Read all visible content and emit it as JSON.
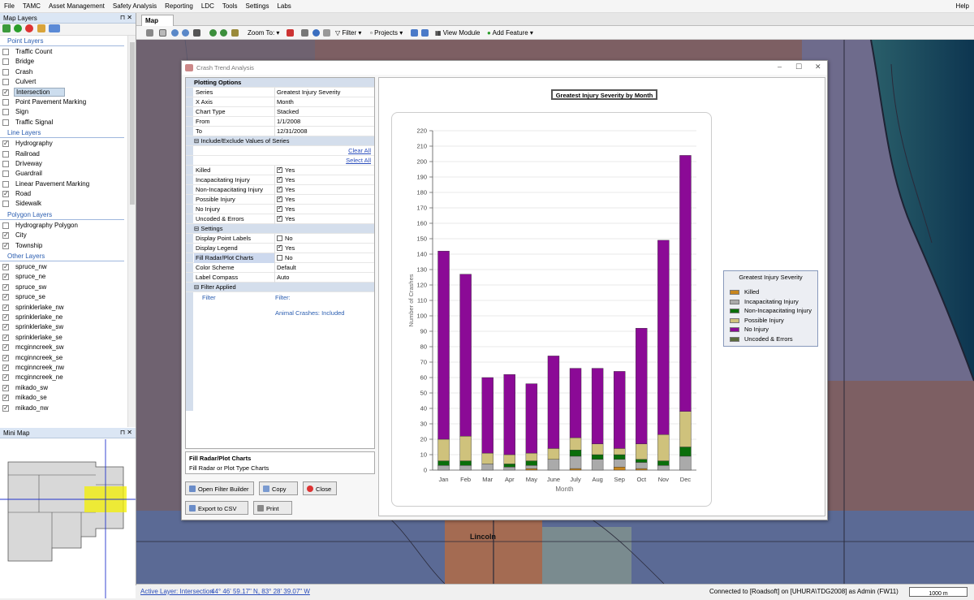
{
  "menu": [
    "File",
    "TAMC",
    "Asset Management",
    "Safety Analysis",
    "Reporting",
    "LDC",
    "Tools",
    "Settings",
    "Labs"
  ],
  "help_label": "Help",
  "map_layers": {
    "title": "Map Layers",
    "groups": [
      {
        "label": "Point Layers",
        "layers": [
          {
            "name": "Traffic Count",
            "checked": false
          },
          {
            "name": "Bridge",
            "checked": false
          },
          {
            "name": "Crash",
            "checked": false
          },
          {
            "name": "Culvert",
            "checked": false
          },
          {
            "name": "Intersection",
            "checked": true,
            "selected": true
          },
          {
            "name": "Point Pavement Marking",
            "checked": false
          },
          {
            "name": "Sign",
            "checked": false
          },
          {
            "name": "Traffic Signal",
            "checked": false
          }
        ]
      },
      {
        "label": "Line Layers",
        "layers": [
          {
            "name": "Hydrography",
            "checked": true
          },
          {
            "name": "Railroad",
            "checked": false
          },
          {
            "name": "Driveway",
            "checked": false
          },
          {
            "name": "Guardrail",
            "checked": false
          },
          {
            "name": "Linear Pavement Marking",
            "checked": false
          },
          {
            "name": "Road",
            "checked": true
          },
          {
            "name": "Sidewalk",
            "checked": false
          }
        ]
      },
      {
        "label": "Polygon Layers",
        "layers": [
          {
            "name": "Hydrography Polygon",
            "checked": false
          },
          {
            "name": "City",
            "checked": true
          },
          {
            "name": "Township",
            "checked": true
          }
        ]
      },
      {
        "label": "Other Layers",
        "layers": [
          {
            "name": "spruce_nw",
            "checked": true
          },
          {
            "name": "spruce_ne",
            "checked": true
          },
          {
            "name": "spruce_sw",
            "checked": true
          },
          {
            "name": "spruce_se",
            "checked": true
          },
          {
            "name": "sprinklerlake_nw",
            "checked": true
          },
          {
            "name": "sprinklerlake_ne",
            "checked": true
          },
          {
            "name": "sprinklerlake_sw",
            "checked": true
          },
          {
            "name": "sprinklerlake_se",
            "checked": true
          },
          {
            "name": "mcginncreek_sw",
            "checked": true
          },
          {
            "name": "mcginncreek_se",
            "checked": true
          },
          {
            "name": "mcginncreek_nw",
            "checked": true
          },
          {
            "name": "mcginncreek_ne",
            "checked": true
          },
          {
            "name": "mikado_sw",
            "checked": true
          },
          {
            "name": "mikado_se",
            "checked": true
          },
          {
            "name": "mikado_nw",
            "checked": true
          }
        ]
      }
    ]
  },
  "mini_map": {
    "title": "Mini Map"
  },
  "map_tab": "Map",
  "map_toolbar": {
    "zoom_to": "Zoom To:",
    "filter": "Filter",
    "projects": "Projects",
    "view_module": "View Module",
    "add_feature": "Add Feature"
  },
  "map_label": "Lincoln",
  "status": {
    "active_layer": "Active Layer: Intersection",
    "coords": "44° 46' 59.17\" N, 83° 28' 39.07\" W",
    "connection": "Connected to [Roadsoft] on [UHURA\\TDG2008] as Admin (FW11)",
    "scale": "1000 m"
  },
  "dialog": {
    "title": "Crash Trend Analysis",
    "plotting_options": "Plotting Options",
    "props": [
      {
        "k": "Series",
        "v": "Greatest Injury Severity"
      },
      {
        "k": "X Axis",
        "v": "Month"
      },
      {
        "k": "Chart Type",
        "v": "Stacked"
      },
      {
        "k": "From",
        "v": "1/1/2008"
      },
      {
        "k": "To",
        "v": "12/31/2008"
      }
    ],
    "include_section": "Include/Exclude Values of Series",
    "clear_all": "Clear All",
    "select_all": "Select All",
    "include_values": [
      {
        "k": "Killed",
        "v": "Yes",
        "checked": true
      },
      {
        "k": "Incapacitating Injury",
        "v": "Yes",
        "checked": true
      },
      {
        "k": "Non-Incapacitating Injury",
        "v": "Yes",
        "checked": true
      },
      {
        "k": "Possible Injury",
        "v": "Yes",
        "checked": true
      },
      {
        "k": "No Injury",
        "v": "Yes",
        "checked": true
      },
      {
        "k": "Uncoded & Errors",
        "v": "Yes",
        "checked": true
      }
    ],
    "settings_section": "Settings",
    "settings": [
      {
        "k": "Display Point Labels",
        "v": "No",
        "checked": false,
        "cb": true
      },
      {
        "k": "Display Legend",
        "v": "Yes",
        "checked": true,
        "cb": true
      },
      {
        "k": "Fill Radar/Plot Charts",
        "v": "No",
        "checked": false,
        "cb": true,
        "hl": true
      },
      {
        "k": "Color Scheme",
        "v": "Default",
        "cb": false
      },
      {
        "k": "Label Compass",
        "v": "Auto",
        "cb": false
      }
    ],
    "filter_section": "Filter Applied",
    "filter_key": "Filter",
    "filter_value": "Filter:",
    "filter_detail": "Animal Crashes:  Included",
    "desc_title": "Fill Radar/Plot Charts",
    "desc_text": "Fill Radar or Plot Type Charts",
    "buttons": {
      "open_filter": "Open Filter Builder",
      "copy": "Copy",
      "close": "Close",
      "export": "Export to CSV",
      "print": "Print"
    }
  },
  "chart_data": {
    "type": "bar",
    "stacked": true,
    "title": "Greatest Injury Severity by Month",
    "xlabel": "Month",
    "ylabel": "Number of Crashes",
    "ylim": [
      0,
      220
    ],
    "yticks": [
      0,
      10,
      20,
      30,
      40,
      50,
      60,
      70,
      80,
      90,
      100,
      110,
      120,
      130,
      140,
      150,
      160,
      170,
      180,
      190,
      200,
      210,
      220
    ],
    "grid": true,
    "legend_title": "Greatest Injury Severity",
    "legend_position": "right",
    "categories": [
      "Jan",
      "Feb",
      "Mar",
      "Apr",
      "May",
      "June",
      "July",
      "Aug",
      "Sep",
      "Oct",
      "Nov",
      "Dec"
    ],
    "series": [
      {
        "name": "Killed",
        "color": "#c8861e",
        "values": [
          0,
          0,
          0,
          0,
          1,
          0,
          1,
          0,
          2,
          1,
          0,
          0
        ]
      },
      {
        "name": "Incapacitating Injury",
        "color": "#aaaaaa",
        "values": [
          3,
          3,
          4,
          2,
          2,
          7,
          8,
          7,
          5,
          4,
          3,
          9
        ]
      },
      {
        "name": "Non-Incapacitating Injury",
        "color": "#0a6e0a",
        "values": [
          3,
          3,
          0,
          2,
          3,
          0,
          4,
          3,
          3,
          2,
          3,
          6
        ]
      },
      {
        "name": "Possible Injury",
        "color": "#cfc27c",
        "values": [
          14,
          16,
          7,
          6,
          5,
          7,
          8,
          7,
          4,
          10,
          17,
          23
        ]
      },
      {
        "name": "No Injury",
        "color": "#8b0a96",
        "values": [
          122,
          105,
          49,
          52,
          45,
          60,
          45,
          49,
          50,
          75,
          126,
          166
        ]
      },
      {
        "name": "Uncoded & Errors",
        "color": "#5a6b3c",
        "values": [
          0,
          0,
          0,
          0,
          0,
          0,
          0,
          0,
          0,
          0,
          0,
          0
        ]
      }
    ]
  }
}
